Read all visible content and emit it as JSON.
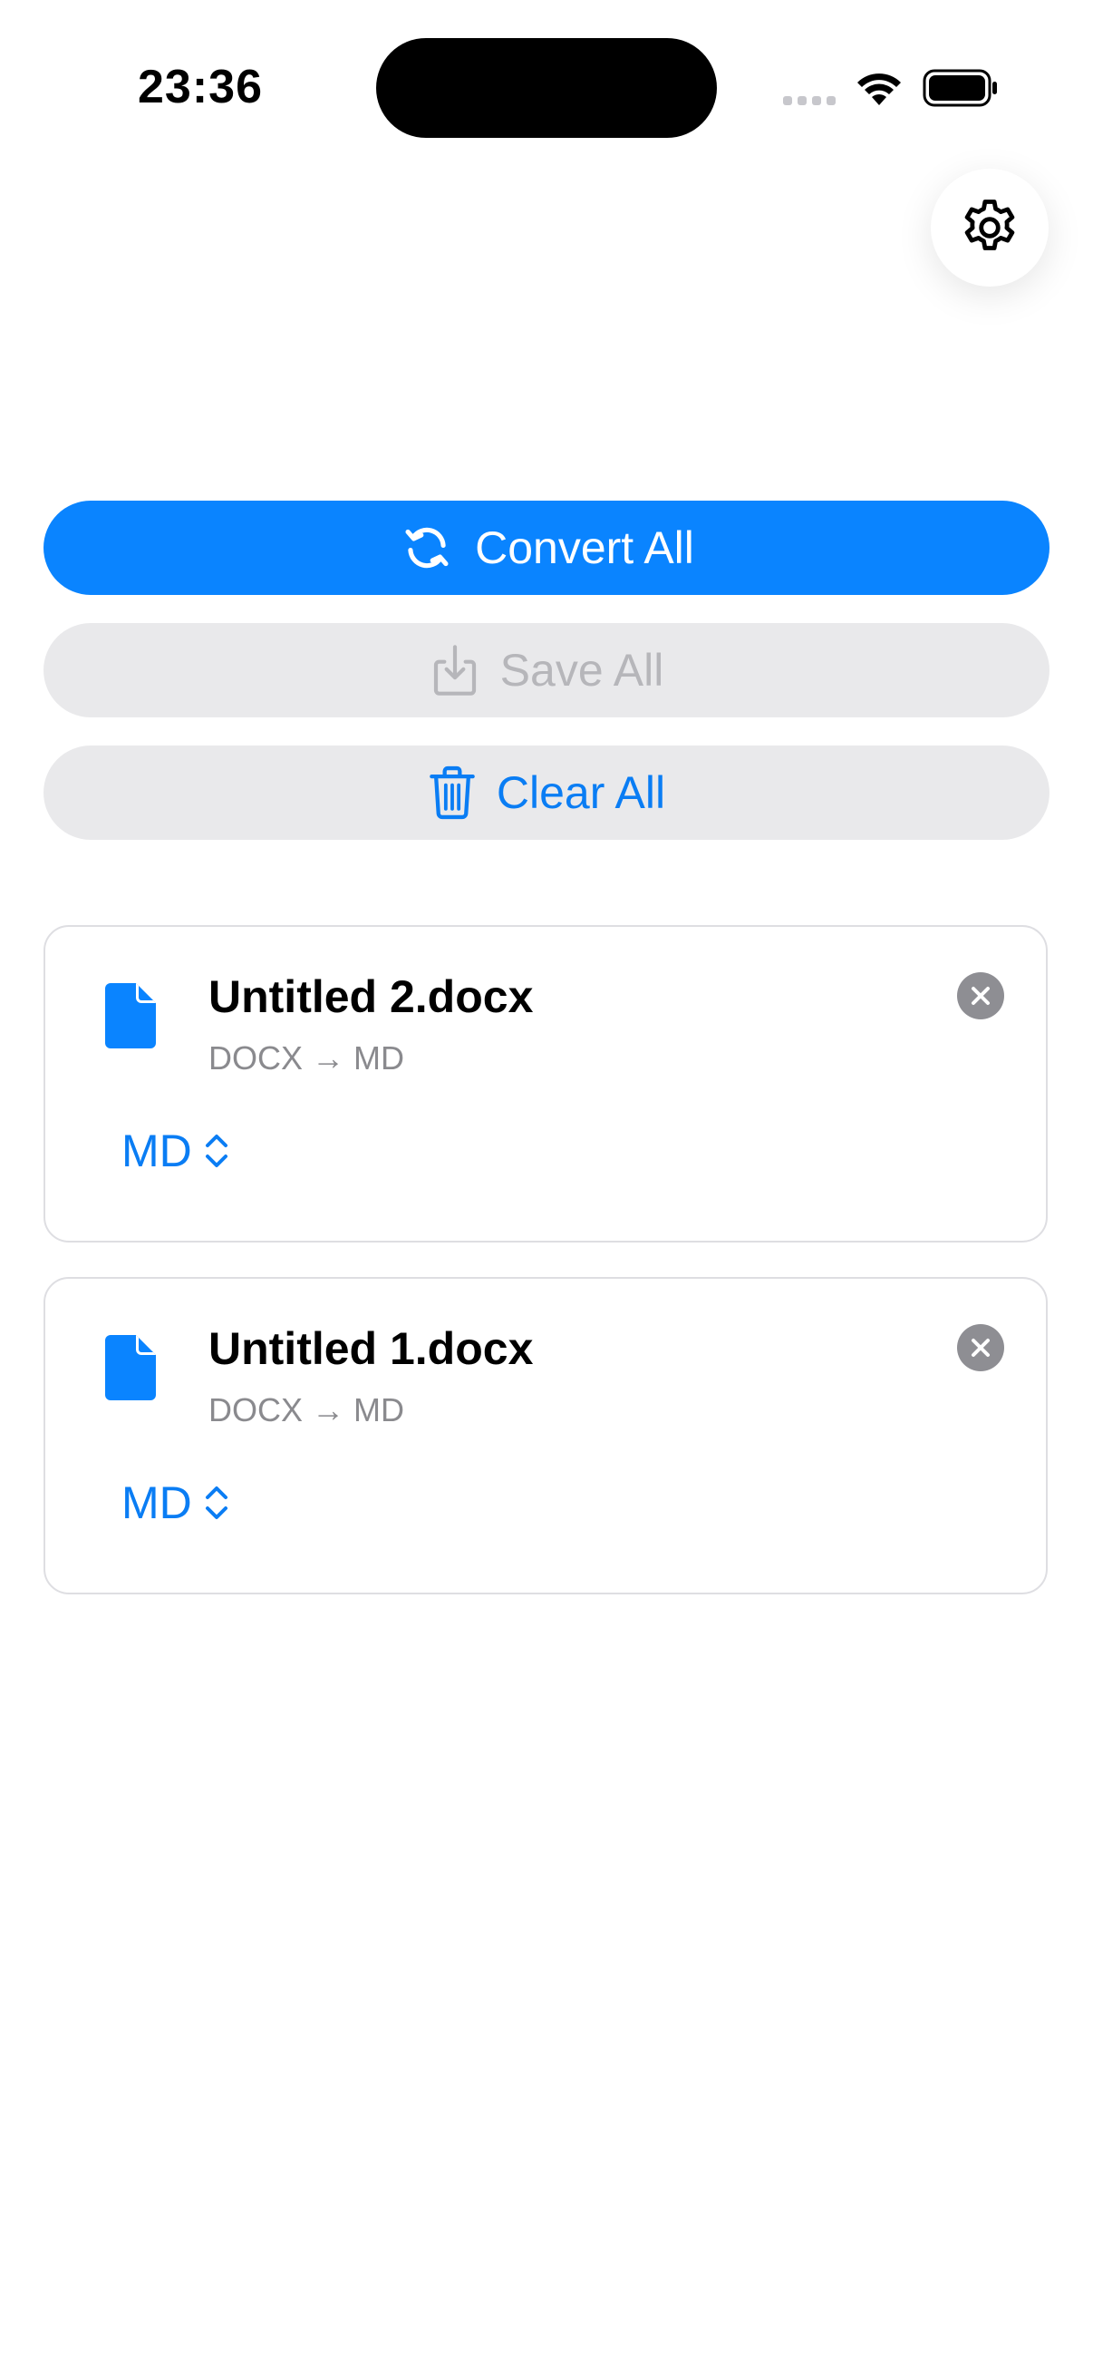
{
  "status_bar": {
    "time": "23:36"
  },
  "settings": {
    "icon": "gear-icon"
  },
  "actions": {
    "convert_label": "Convert All",
    "save_label": "Save All",
    "clear_label": "Clear All"
  },
  "files": [
    {
      "name": "Untitled 2.docx",
      "conversion": "DOCX → MD",
      "format": "MD"
    },
    {
      "name": "Untitled 1.docx",
      "conversion": "DOCX → MD",
      "format": "MD"
    }
  ],
  "colors": {
    "accent": "#0a84ff",
    "link": "#0a7df4",
    "disabled_text": "#b6b6ba",
    "secondary_button_bg": "#e9e9eb",
    "subtitle": "#8a8a8e",
    "remove_icon": "#8e8e93"
  }
}
